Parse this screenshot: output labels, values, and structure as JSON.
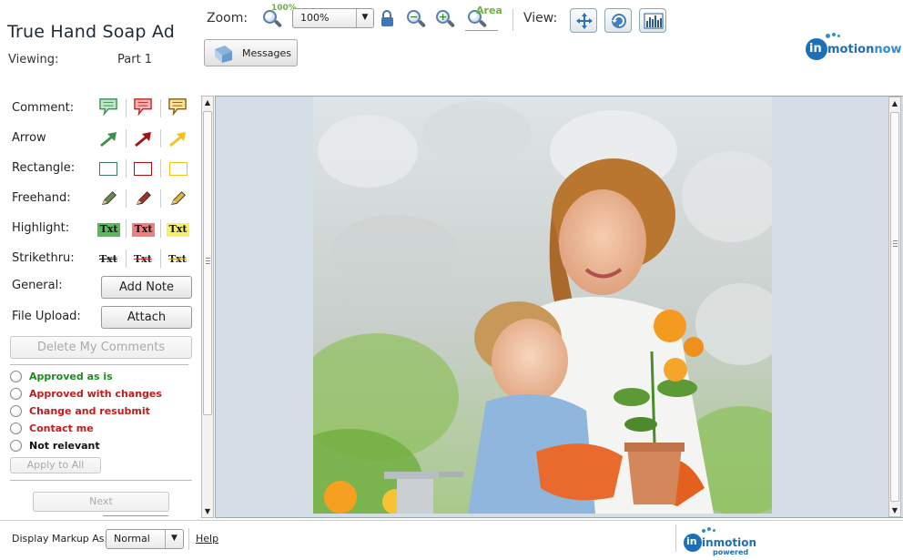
{
  "header": {
    "title": "True Hand Soap Ad",
    "viewing_label": "Viewing:",
    "viewing_value": "Part 1",
    "messages_label": "Messages"
  },
  "toolbar": {
    "zoom_label": "Zoom:",
    "zoom_100_tag": "100%",
    "zoom_value": "100%",
    "zoom_area_tag": "Area",
    "view_label": "View:"
  },
  "logos": {
    "main": "inmotionnow",
    "footer": "inmotion",
    "footer_sub": "powered"
  },
  "tools": {
    "comment_label": "Comment:",
    "arrow_label": "Arrow",
    "rectangle_label": "Rectangle:",
    "freehand_label": "Freehand:",
    "highlight_label": "Highlight:",
    "strikethru_label": "Strikethru:",
    "general_label": "General:",
    "file_upload_label": "File Upload:",
    "sample_text": "Txt",
    "colors": {
      "green": "#3e8f4a",
      "red": "#a31313",
      "yellow": "#f2c21b"
    }
  },
  "buttons": {
    "add_note": "Add Note",
    "attach": "Attach",
    "delete_comments": "Delete My Comments",
    "apply_all": "Apply to All",
    "next": "Next"
  },
  "approval": [
    {
      "label": "Approved as is",
      "color": "#1e8a1e"
    },
    {
      "label": "Approved with changes",
      "color": "#c21b1b"
    },
    {
      "label": "Change and resubmit",
      "color": "#c21b1b"
    },
    {
      "label": "Contact me",
      "color": "#c21b1b"
    },
    {
      "label": "Not relevant",
      "color": "#111111"
    }
  ],
  "footer": {
    "display_markup_label": "Display Markup As:",
    "markup_value": "Normal",
    "help_label": "Help"
  }
}
